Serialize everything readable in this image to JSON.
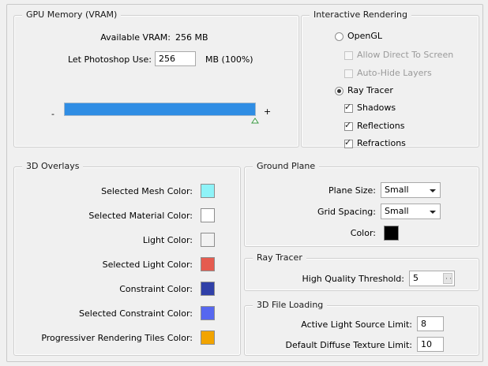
{
  "gpu_memory": {
    "title": "GPU Memory (VRAM)",
    "available_label": "Available VRAM:",
    "available_value": "256 MB",
    "let_photoshop_use_label": "Let Photoshop Use:",
    "let_photoshop_use_value": "256",
    "unit_label": "MB (100%)",
    "slider_minus": "-",
    "slider_plus": "+",
    "slider_level_percent": 100,
    "slider_color": "#2f8de4"
  },
  "interactive_rendering": {
    "title": "Interactive Rendering",
    "opengl_label": "OpenGL",
    "allow_direct_label": "Allow Direct To Screen",
    "auto_hide_label": "Auto-Hide Layers",
    "ray_tracer_label": "Ray Tracer",
    "shadows_label": "Shadows",
    "reflections_label": "Reflections",
    "refractions_label": "Refractions",
    "opengl_selected": false,
    "ray_tracer_selected": true,
    "check_mark": "✓"
  },
  "overlays": {
    "title": "3D Overlays",
    "items": [
      {
        "label": "Selected Mesh Color:",
        "color": "#8ef3f8"
      },
      {
        "label": "Selected Material Color:",
        "color": "#ffffff"
      },
      {
        "label": "Light Color:",
        "color": "#f2f2f2"
      },
      {
        "label": "Selected Light Color:",
        "color": "#e55b4f"
      },
      {
        "label": "Constraint Color:",
        "color": "#3040a8"
      },
      {
        "label": "Selected Constraint Color:",
        "color": "#5667ef"
      },
      {
        "label": "Progressiver Rendering Tiles Color:",
        "color": "#f2a400"
      }
    ]
  },
  "ground_plane": {
    "title": "Ground Plane",
    "plane_size_label": "Plane Size:",
    "plane_size_value": "Small",
    "grid_spacing_label": "Grid Spacing:",
    "grid_spacing_value": "Small",
    "color_label": "Color:",
    "color_value": "#000000"
  },
  "ray_tracer": {
    "title": "Ray Tracer",
    "threshold_label": "High Quality Threshold:",
    "threshold_value": "5"
  },
  "file_loading": {
    "title": "3D File Loading",
    "light_limit_label": "Active Light Source Limit:",
    "light_limit_value": "8",
    "texture_limit_label": "Default Diffuse Texture Limit:",
    "texture_limit_value": "10"
  }
}
